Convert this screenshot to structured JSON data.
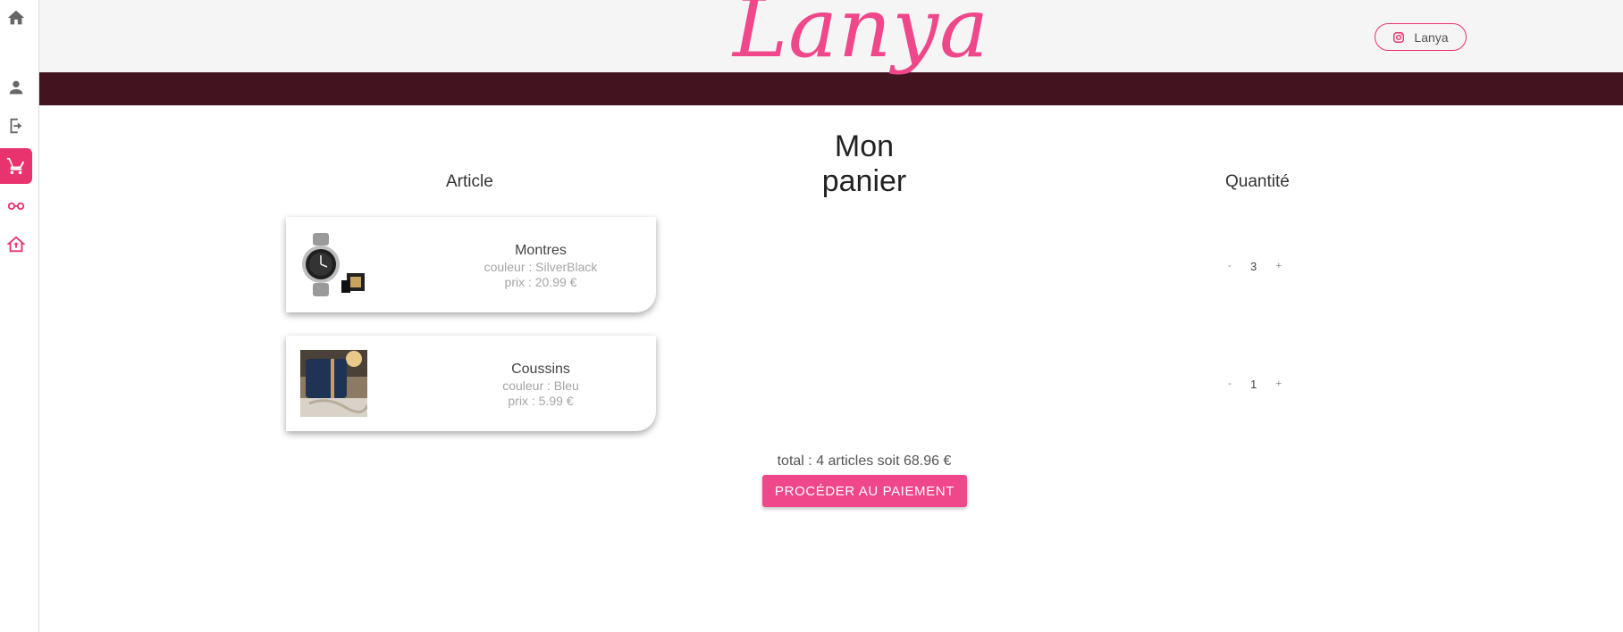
{
  "app": {
    "logo_text": "Lanya",
    "brand_color": "#f0468a",
    "band_color": "#421420"
  },
  "sidebar": {
    "items": [
      {
        "icon": "home-icon"
      },
      {
        "icon": "user-icon"
      },
      {
        "icon": "logout-icon"
      },
      {
        "icon": "cart-icon",
        "active": true
      },
      {
        "icon": "glasses-icon"
      },
      {
        "icon": "store-home-icon"
      }
    ]
  },
  "header": {
    "instagram_label": "Lanya",
    "instagram_icon": "instagram-icon"
  },
  "cart": {
    "title": "Mon panier",
    "col_article": "Article",
    "col_quantity": "Quantité",
    "items": [
      {
        "name": "Montres",
        "color": "couleur : SilverBlack",
        "price": "prix : 20.99 €",
        "qty": "3",
        "minus": "-",
        "plus": "+"
      },
      {
        "name": "Coussins",
        "color": "couleur : Bleu",
        "price": "prix : 5.99 €",
        "qty": "1",
        "minus": "-",
        "plus": "+"
      }
    ],
    "total": "total : 4 articles soit 68.96 €",
    "checkout_label": "PROCÉDER AU PAIEMENT"
  }
}
